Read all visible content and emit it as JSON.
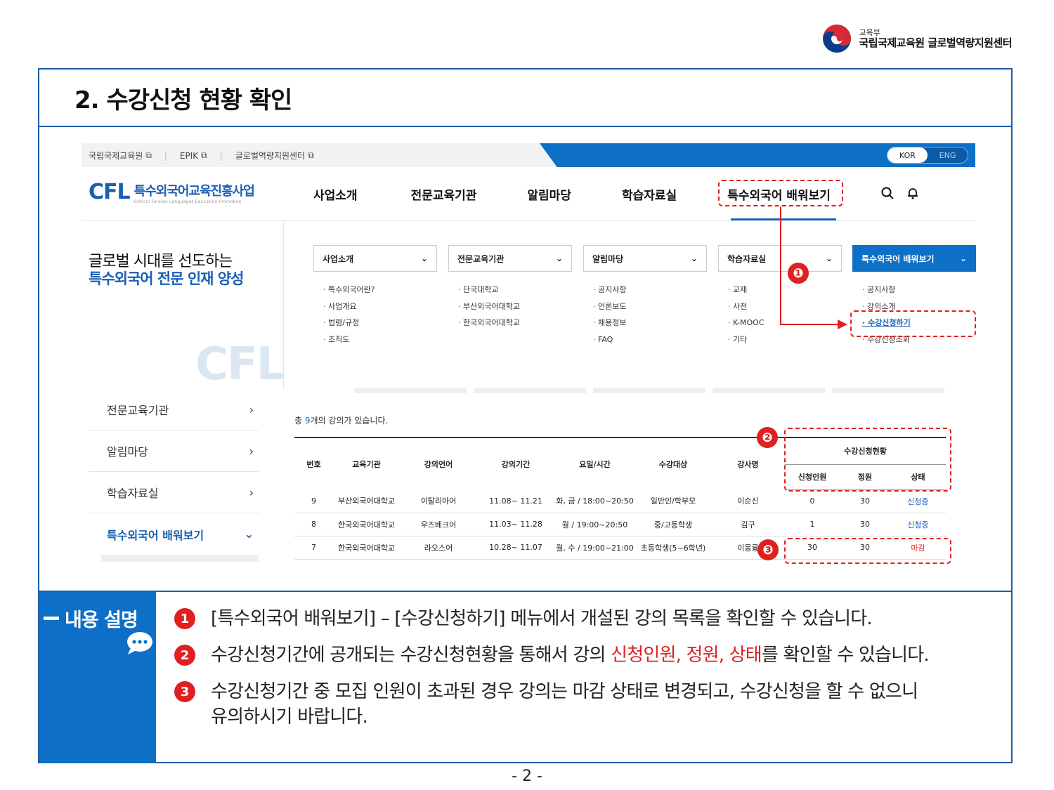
{
  "header_logo": {
    "ministry": "교육부",
    "center": "국립국제교육원 글로벌역량지원센터"
  },
  "title": "2. 수강신청 현황 확인",
  "site": {
    "util_links": [
      "국립국제교육원",
      "EPIK",
      "글로벌역량지원센터"
    ],
    "lang_active": "KOR",
    "lang_inactive": "ENG",
    "logo_mark": "CFL",
    "logo_kr": "특수외국어교육진흥사업",
    "logo_en": "Critical Foreign Languages Education Promotion",
    "gnb": [
      "사업소개",
      "전문교육기관",
      "알림마당",
      "학습자료실",
      "특수외국어 배워보기"
    ],
    "hero_line1": "글로벌 시대를 선도하는",
    "hero_line2": "특수외국어 전문 인재 양성",
    "hero_watermark": "CFL",
    "mega_menu": [
      {
        "head": "사업소개",
        "items": [
          "특수외국어란?",
          "사업개요",
          "법령/규정",
          "조직도"
        ]
      },
      {
        "head": "전문교육기관",
        "items": [
          "단국대학교",
          "부산외국어대학교",
          "한국외국어대학교"
        ]
      },
      {
        "head": "알림마당",
        "items": [
          "공지사항",
          "언론보도",
          "채용정보",
          "FAQ"
        ]
      },
      {
        "head": "학습자료실",
        "items": [
          "교재",
          "사전",
          "K-MOOC",
          "기타"
        ]
      },
      {
        "head": "특수외국어 배워보기",
        "items": [
          "공지사항",
          "강의소개",
          "수강신청하기",
          "수강신청조회"
        ]
      }
    ],
    "side_menu": [
      "전문교육기관",
      "알림마당",
      "학습자료실",
      "특수외국어 배워보기"
    ],
    "count_prefix": "총 ",
    "count_num": "9",
    "count_suffix": "개의 강의가 있습니다.",
    "table": {
      "headers": [
        "번호",
        "교육기관",
        "강의언어",
        "강의기간",
        "요일/시간",
        "수강대상",
        "강사명"
      ],
      "group_header": "수강신청현황",
      "sub_headers": [
        "신청인원",
        "정원",
        "상태"
      ],
      "rows": [
        [
          "9",
          "부산외국어대학교",
          "이탈리아어",
          "11.08~ 11.21",
          "화, 금 / 18:00~20:50",
          "일반인/학부모",
          "이순신",
          "0",
          "30",
          "신청중"
        ],
        [
          "8",
          "한국외국어대학교",
          "우즈베크어",
          "11.03~ 11.28",
          "월 / 19:00~20:50",
          "중/고등학생",
          "김구",
          "1",
          "30",
          "신청중"
        ],
        [
          "7",
          "한국외국어대학교",
          "라오스어",
          "10.28~ 11.07",
          "월, 수 / 19:00~21:00",
          "초등학생(5~6학년)",
          "이몽룡",
          "30",
          "30",
          "마감"
        ]
      ]
    }
  },
  "badges": [
    "❶",
    "❷",
    "❸"
  ],
  "explain": {
    "label": "내용 설명",
    "points": [
      {
        "num": "1",
        "text": "[특수외국어 배워보기] – [수강신청하기] 메뉴에서 개설된 강의 목록을 확인할 수 있습니다."
      },
      {
        "num": "2",
        "text_a": "수강신청기간에 공개되는 수강신청현황을 통해서 강의 ",
        "text_hl": "신청인원, 정원, 상태",
        "text_b": "를 확인할 수 있습니다."
      },
      {
        "num": "3",
        "text": "수강신청기간 중 모집 인원이 초과된 경우 강의는 마감 상태로 변경되고, 수강신청을 할 수 없으니 유의하시기 바랍니다."
      }
    ]
  },
  "page_number": "- 2 -",
  "colors": {
    "accent": "#0d6fc6",
    "frame": "#1d5fa8",
    "highlight": "#e02020"
  }
}
